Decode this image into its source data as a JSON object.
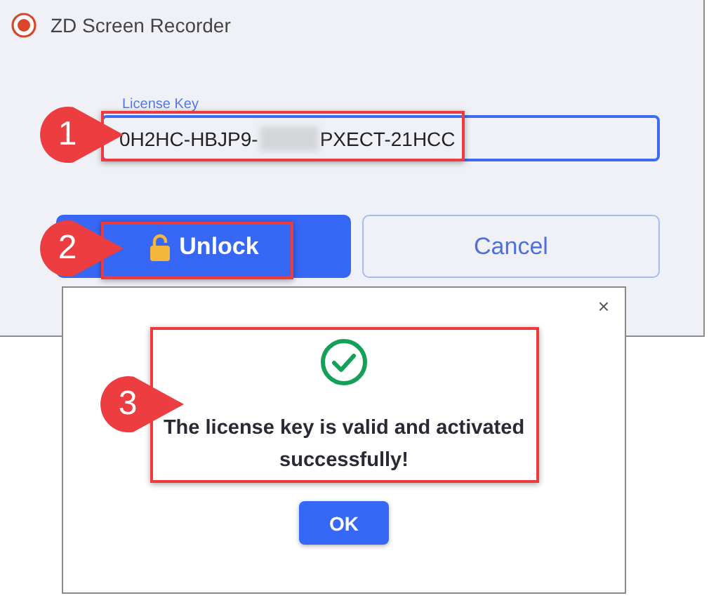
{
  "window": {
    "title": "ZD Screen Recorder"
  },
  "license_field": {
    "label": "License Key",
    "value_start": "0H2HC-HBJP9-",
    "value_end": "PXECT-21HCC",
    "focused": true
  },
  "buttons": [
    {
      "kind": "primary",
      "label": "Unlock"
    },
    {
      "kind": "secondary",
      "label": "Cancel"
    }
  ],
  "dialog": {
    "close": "×",
    "message": "The license key is valid and activated successfully!",
    "button": "OK"
  },
  "callouts": [
    {
      "number": "1"
    },
    {
      "number": "2"
    },
    {
      "number": "3"
    }
  ]
}
